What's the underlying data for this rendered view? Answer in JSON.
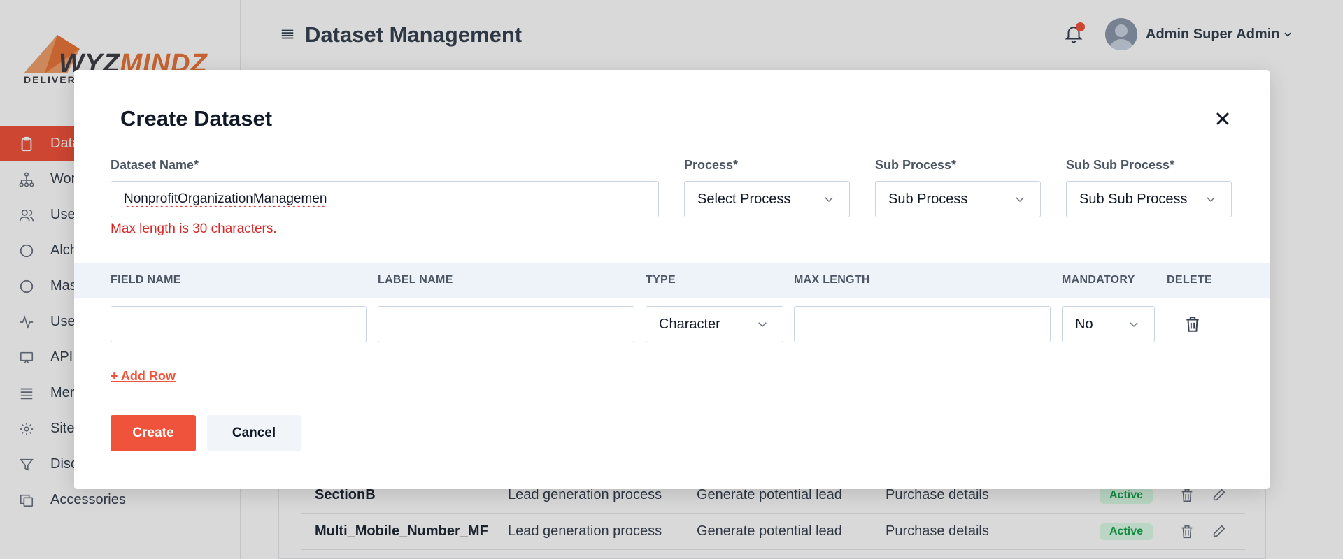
{
  "app": {
    "logo": {
      "word_a": "WYZ",
      "word_b": "MINDZ",
      "tagline": "DELIVER"
    },
    "page_title": "Dataset Management",
    "user": {
      "name": "Admin Super Admin"
    },
    "colors": {
      "accent": "#f0533b",
      "active_badge_bg": "#dcfce7",
      "active_badge_text": "#16a34a",
      "error": "#dc2626"
    }
  },
  "sidebar": {
    "items": [
      {
        "label": "Data",
        "icon": "clipboard-icon",
        "active": true
      },
      {
        "label": "Wor",
        "icon": "workflow-icon"
      },
      {
        "label": "Use",
        "icon": "users-icon"
      },
      {
        "label": "Alch",
        "icon": "circle-icon"
      },
      {
        "label": "Mas",
        "icon": "circle-icon"
      },
      {
        "label": "Use",
        "icon": "activity-icon"
      },
      {
        "label": "API",
        "icon": "monitor-icon"
      },
      {
        "label": "Mer",
        "icon": "list-icon"
      },
      {
        "label": "Site",
        "icon": "gear-icon"
      },
      {
        "label": "Disc",
        "icon": "filter-icon"
      },
      {
        "label": "Accessories",
        "icon": "copy-icon"
      }
    ]
  },
  "background_table": {
    "rows": [
      {
        "name": "SectionB",
        "process": "Lead generation process",
        "sub_process": "Generate potential lead",
        "sub_sub_process": "Purchase details",
        "status": "Active"
      },
      {
        "name": "Multi_Mobile_Number_MF",
        "process": "Lead generation process",
        "sub_process": "Generate potential lead",
        "sub_sub_process": "Purchase details",
        "status": "Active"
      }
    ]
  },
  "modal": {
    "title": "Create Dataset",
    "dataset_name": {
      "label": "Dataset Name*",
      "value": "NonprofitOrganizationManagemen",
      "error": "Max length is 30 characters."
    },
    "process": {
      "label": "Process*",
      "value": "Select Process"
    },
    "sub_process": {
      "label": "Sub Process*",
      "value": "Sub Process"
    },
    "sub_sub_process": {
      "label": "Sub Sub Process*",
      "value": "Sub Sub Process"
    },
    "table": {
      "headers": {
        "field_name": "FIELD NAME",
        "label_name": "LABEL NAME",
        "type": "TYPE",
        "max_length": "MAX LENGTH",
        "mandatory": "MANDATORY",
        "delete": "DELETE"
      },
      "row": {
        "field_name": "",
        "label_name": "",
        "type": "Character",
        "max_length": "",
        "mandatory": "No"
      }
    },
    "add_row": "+ Add Row",
    "create_label": "Create",
    "cancel_label": "Cancel"
  }
}
